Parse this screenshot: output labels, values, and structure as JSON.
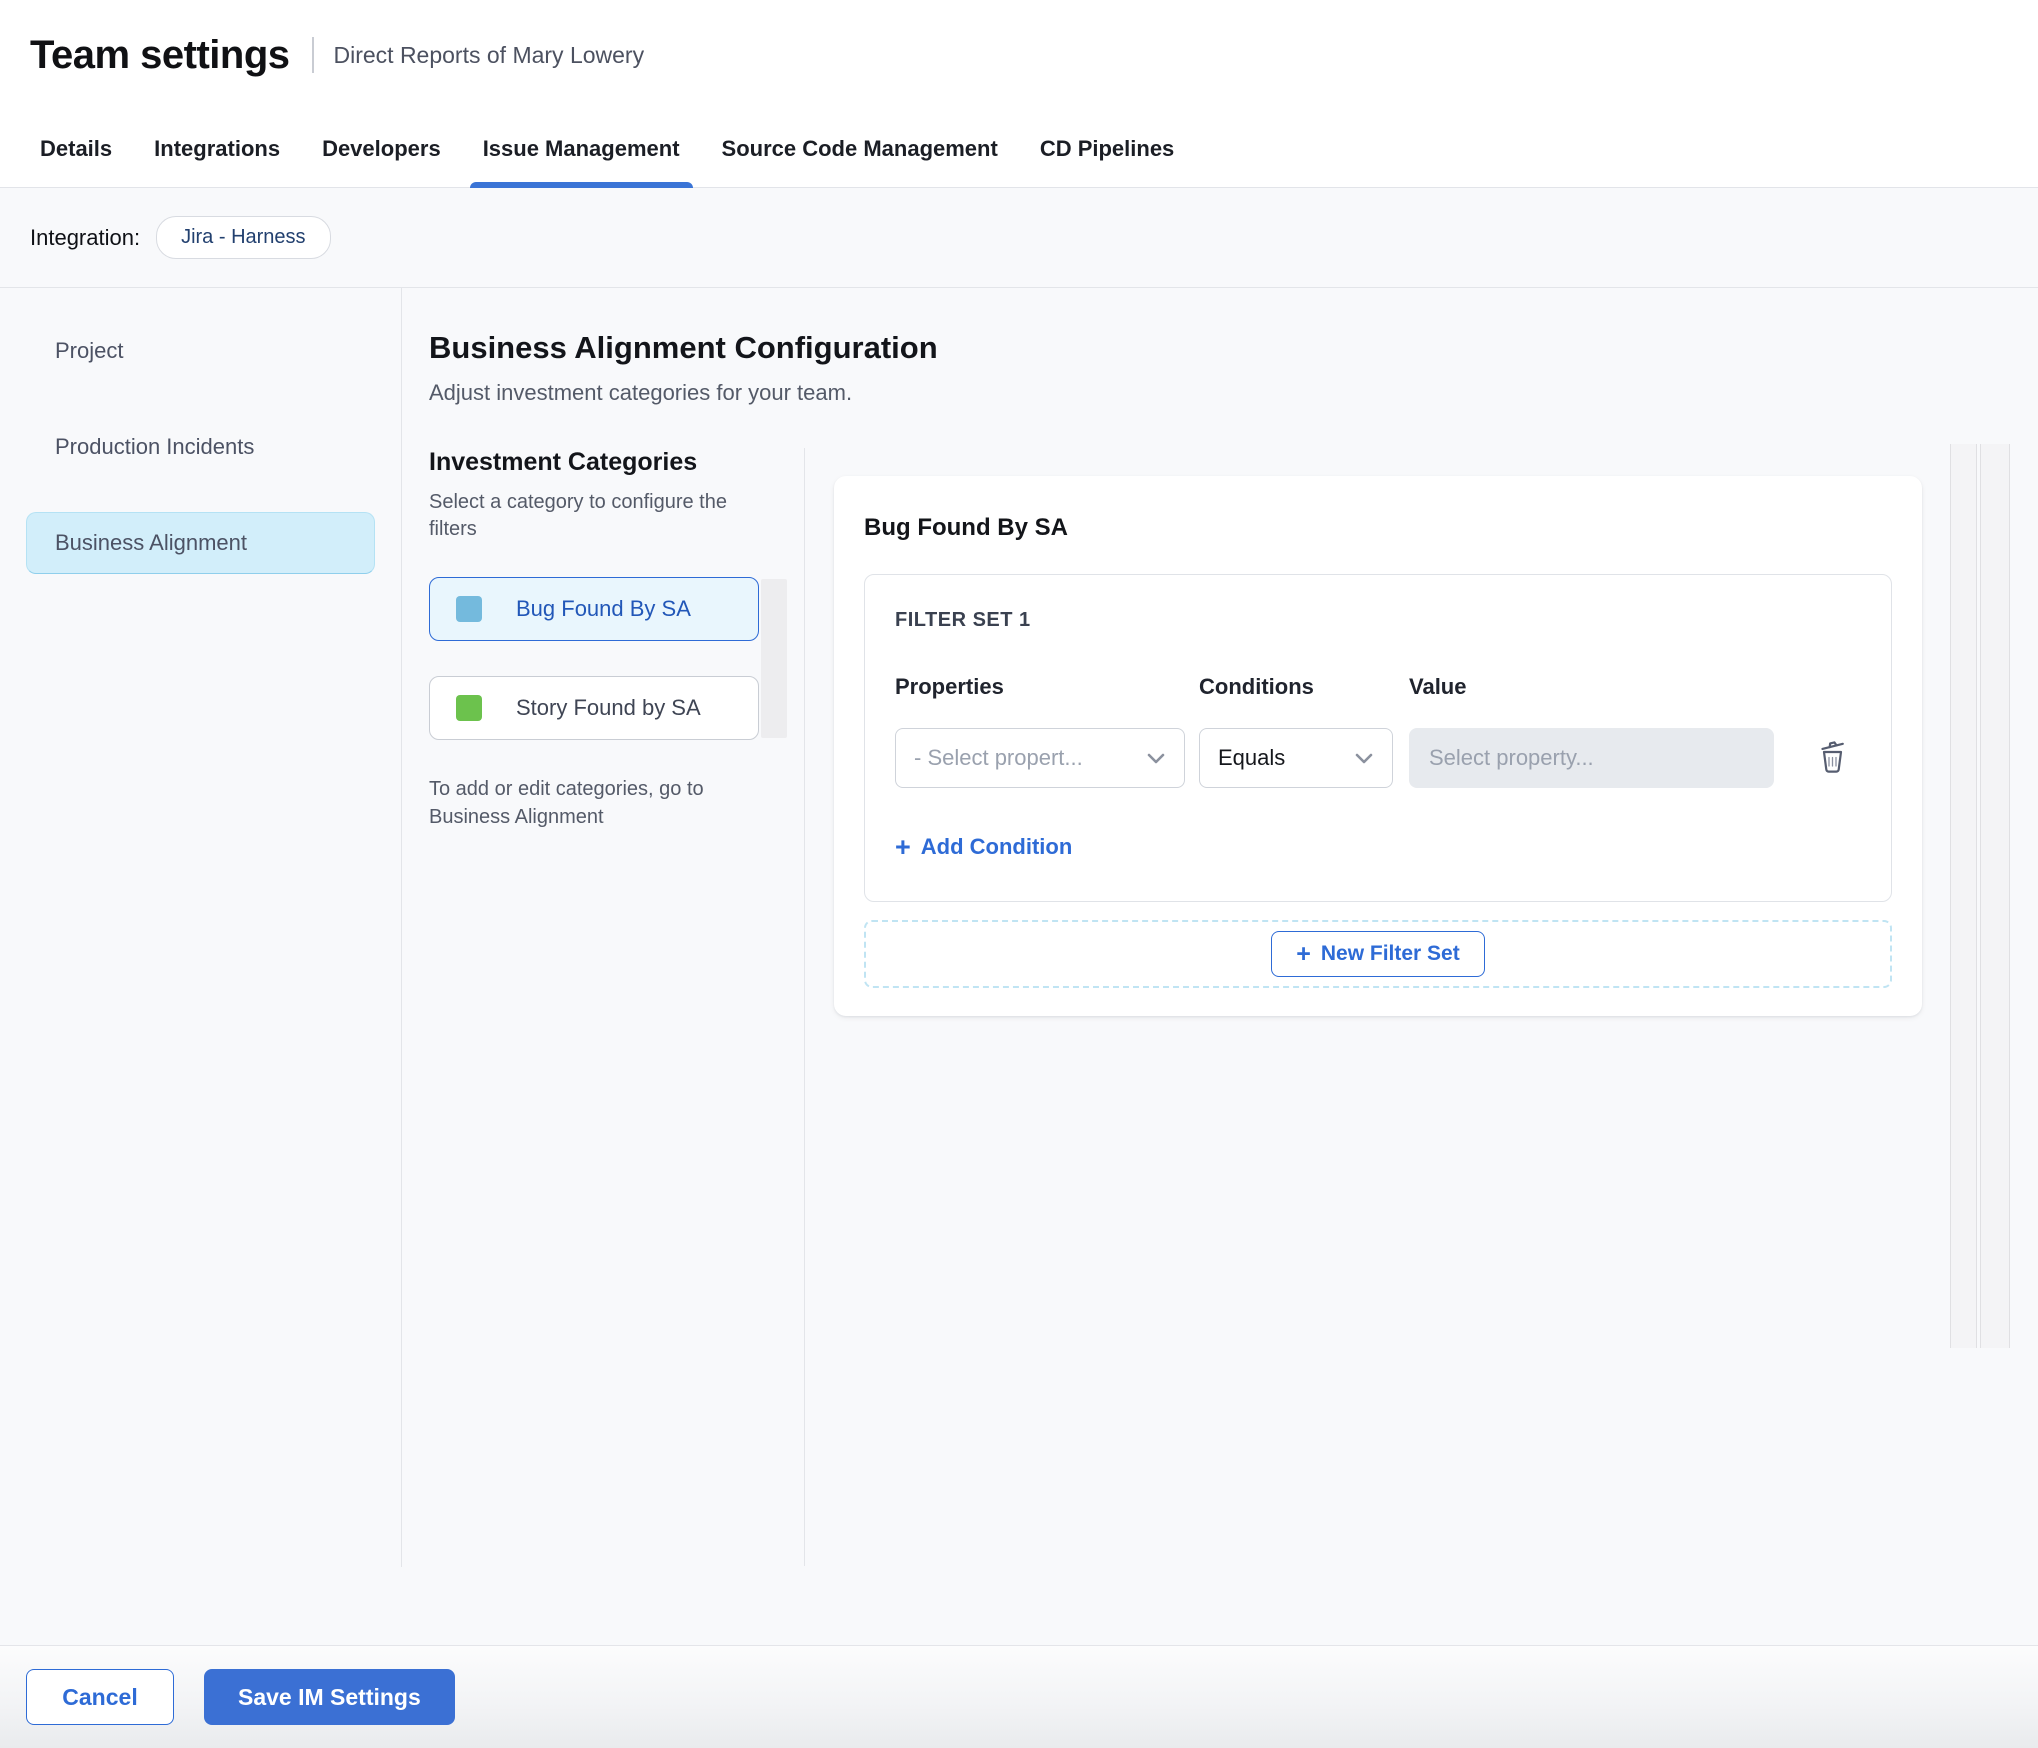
{
  "header": {
    "title": "Team settings",
    "subtitle": "Direct Reports of Mary Lowery"
  },
  "tabs": {
    "items": [
      {
        "label": "Details",
        "active": false
      },
      {
        "label": "Integrations",
        "active": false
      },
      {
        "label": "Developers",
        "active": false
      },
      {
        "label": "Issue Management",
        "active": true
      },
      {
        "label": "Source Code Management",
        "active": false
      },
      {
        "label": "CD Pipelines",
        "active": false
      }
    ]
  },
  "integration": {
    "label": "Integration:",
    "value": "Jira - Harness"
  },
  "sidebar": {
    "items": [
      {
        "label": "Project",
        "active": false
      },
      {
        "label": "Production Incidents",
        "active": false
      },
      {
        "label": "Business Alignment",
        "active": true
      }
    ]
  },
  "main": {
    "heading": "Business Alignment Configuration",
    "subheading": "Adjust investment categories for your team.",
    "categories": {
      "title": "Investment Categories",
      "hint": "Select a category to configure the filters",
      "items": [
        {
          "label": "Bug Found By SA",
          "color": "#74badd",
          "selected": true
        },
        {
          "label": "Story Found by SA",
          "color": "#6cc24d",
          "selected": false
        }
      ],
      "note": "To add or edit categories, go to Business Alignment"
    },
    "panel": {
      "title": "Bug Found By SA",
      "filter_set": {
        "title": "FILTER SET 1",
        "columns": [
          "Properties",
          "Conditions",
          "Value"
        ],
        "property_placeholder": "- Select propert...",
        "condition_value": "Equals",
        "value_placeholder": "Select property...",
        "add_condition_label": "Add Condition"
      },
      "new_filter_set_label": "New Filter Set"
    }
  },
  "footer": {
    "cancel_label": "Cancel",
    "save_label": "Save IM Settings"
  },
  "icons": {
    "plus": "+",
    "chevron_down": "chevron-down",
    "trash": "trash"
  },
  "colors": {
    "accent": "#2e6bd6",
    "tab_underline": "#3a74d6",
    "save_button": "#3b70d4",
    "active_nav_bg": "#d2eefa",
    "selected_category_bg": "#e9f6fd",
    "bug_swatch": "#74badd",
    "story_swatch": "#6cc24d"
  }
}
